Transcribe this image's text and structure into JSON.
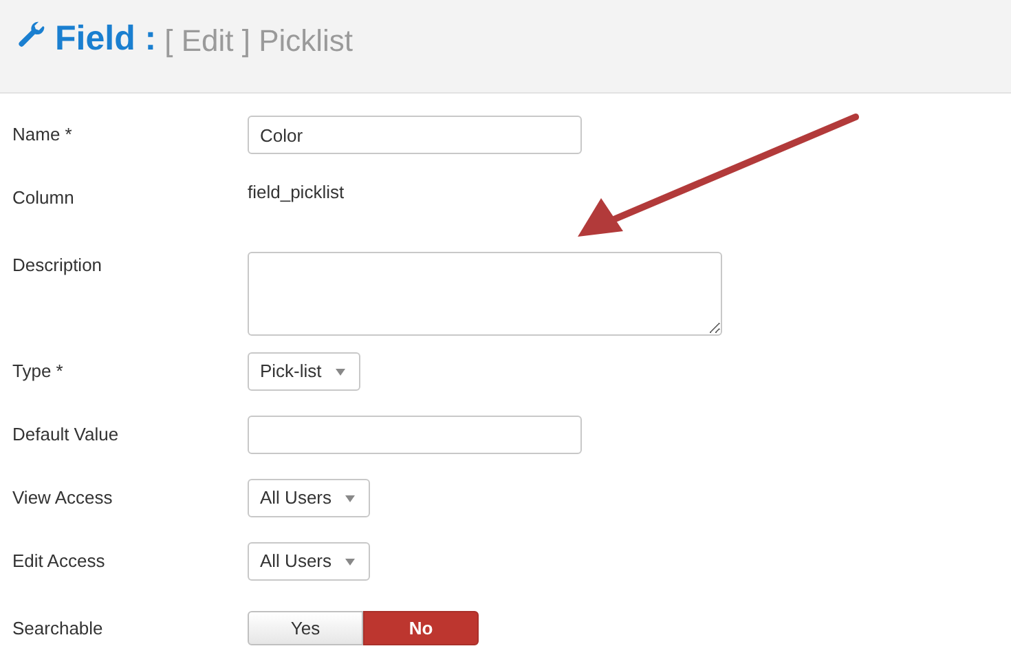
{
  "header": {
    "title": "Field :",
    "subtitle": "[ Edit ] Picklist"
  },
  "rows": [
    {
      "label": "Name *",
      "kind": "text",
      "value": "Color"
    },
    {
      "label": "Column",
      "kind": "static",
      "value": "field_picklist"
    },
    {
      "label": "Description",
      "kind": "textarea",
      "value": ""
    },
    {
      "label": "Type *",
      "kind": "select",
      "value": "Pick-list"
    },
    {
      "label": "Default Value",
      "kind": "text",
      "value": ""
    },
    {
      "label": "View Access",
      "kind": "select",
      "value": "All Users"
    },
    {
      "label": "Edit Access",
      "kind": "select",
      "value": "All Users"
    },
    {
      "label": "Searchable",
      "kind": "toggle",
      "options": [
        {
          "label": "Yes",
          "selected": false
        },
        {
          "label": "No",
          "selected": true
        }
      ]
    }
  ]
}
